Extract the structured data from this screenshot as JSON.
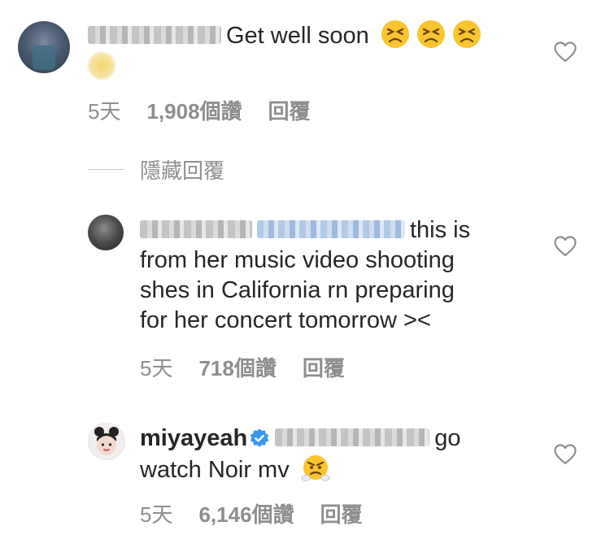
{
  "comments": [
    {
      "text": "Get well soon",
      "time": "5天",
      "likes": "1,908個讚",
      "reply": "回覆"
    },
    {
      "text": "this is from her music video shooting shes in California rn preparing for her concert tomorrow ><",
      "line1": "this is",
      "line2": "from her music video shooting",
      "line3": "shes in California rn preparing",
      "line4": "for her concert tomorrow ><",
      "time": "5天",
      "likes": "718個讚",
      "reply": "回覆"
    },
    {
      "username": "miyayeah",
      "text": "go watch Noir mv",
      "line1": "go",
      "line2": "watch Noir mv",
      "time": "5天",
      "likes": "6,146個讚",
      "reply": "回覆"
    }
  ],
  "hide_replies": "隱藏回覆",
  "icons": {
    "like": "heart-outline-icon",
    "verified": "verified-badge-icon",
    "emoji_1": "persevering-face-emoji",
    "emoji_3": "face-with-steam-emoji"
  },
  "colors": {
    "text": "#262626",
    "meta": "#8e8e8e",
    "verified": "#3897f0"
  }
}
